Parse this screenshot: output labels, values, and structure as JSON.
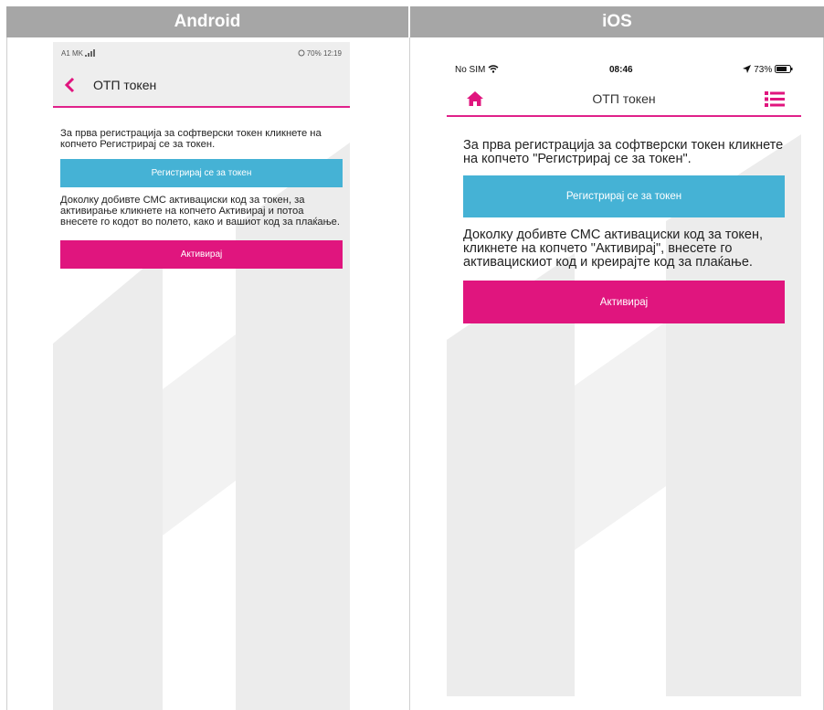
{
  "headers": {
    "android": "Android",
    "ios": "iOS"
  },
  "android": {
    "status": {
      "carrier": "A1 MK",
      "battery_time": "70% 12:19"
    },
    "title": "ОТП токен",
    "intro_text": "За прва регистрација за софтверски токен кликнете на копчето Регистрирај се за токен.",
    "register_button": "Регистрирај се за токен",
    "activation_text": "Доколку добивте СМС активациски код за токен, за активирање кликнете на копчето Активирај и потоа внесете го кодот во полето, како и вашиот код за плаќање.",
    "activate_button": "Активирај"
  },
  "ios": {
    "status": {
      "carrier": "No SIM",
      "time": "08:46",
      "battery": "73%"
    },
    "title": "ОТП токен",
    "intro_text": "За прва регистрација за софтверски токен кликнете на копчето  \"Регистрирај се за токен\".",
    "register_button": "Регистрирај се за токен",
    "activation_text": "Доколку добивте СМС активациски код за токен, кликнете на копчето \"Активирај\", внесете го активацискиот код и креирајте код за плаќање.",
    "activate_button": "Активирај"
  },
  "colors": {
    "accent_pink": "#e0157e",
    "button_blue": "#45b2d5",
    "header_gray": "#a6a6a6",
    "watermark": "#ececec"
  },
  "icons": [
    "back-chevron-icon",
    "signal-icon",
    "alarm-icon",
    "battery-icon",
    "wifi-icon",
    "location-icon",
    "home-icon",
    "menu-list-icon"
  ]
}
